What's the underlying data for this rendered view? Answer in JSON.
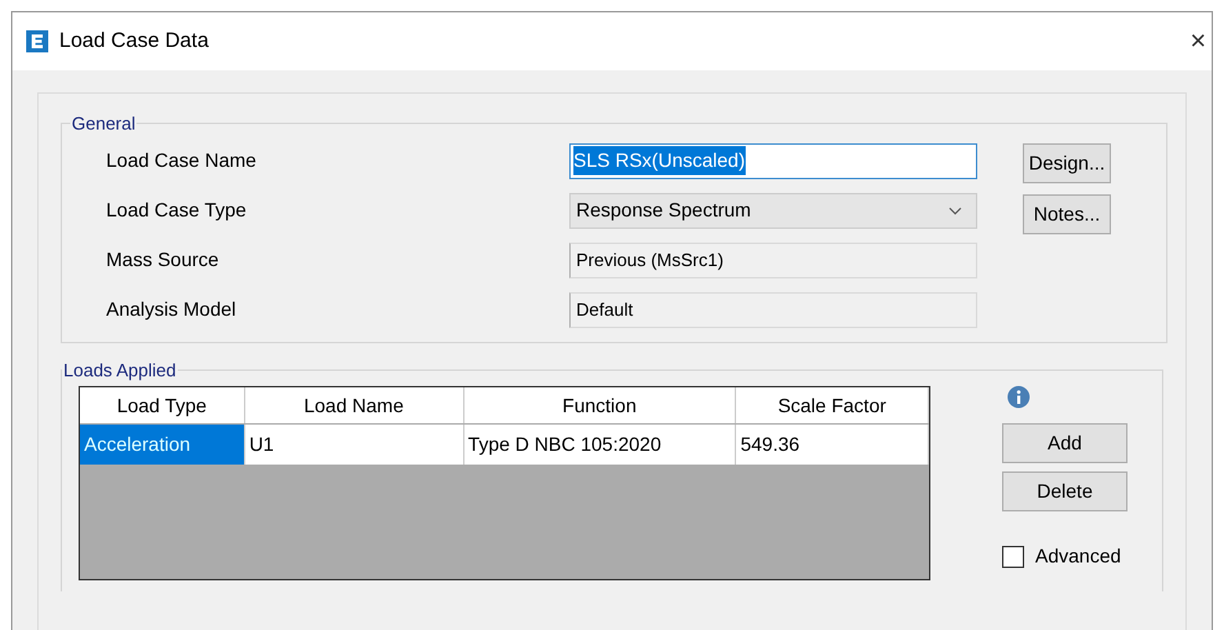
{
  "window": {
    "title": "Load Case Data",
    "close": "×"
  },
  "general": {
    "title": "General",
    "fields": [
      {
        "label": "Load Case Name",
        "kind": "text",
        "value": "SLS RSx(Unscaled)",
        "selected": true
      },
      {
        "label": "Load Case Type",
        "kind": "dropdown",
        "value": "Response Spectrum"
      },
      {
        "label": "Mass Source",
        "kind": "readonly",
        "value": "Previous  (MsSrc1)"
      },
      {
        "label": "Analysis Model",
        "kind": "readonly",
        "value": "Default"
      }
    ],
    "buttons": [
      "Design...",
      "Notes..."
    ]
  },
  "loads": {
    "title": "Loads Applied",
    "table": {
      "columns": [
        "Load Type",
        "Load Name",
        "Function",
        "Scale Factor"
      ],
      "rows": [
        {
          "cells": [
            {
              "text": "Acceleration",
              "selected": true
            },
            {
              "text": "U1",
              "selected": false
            },
            {
              "text": "Type D NBC 105:2020",
              "selected": false
            },
            {
              "text": "549.36",
              "selected": false
            }
          ]
        }
      ]
    },
    "buttons": [
      "Add",
      "Delete"
    ],
    "advanced": {
      "label": "Advanced",
      "checked": false
    }
  }
}
